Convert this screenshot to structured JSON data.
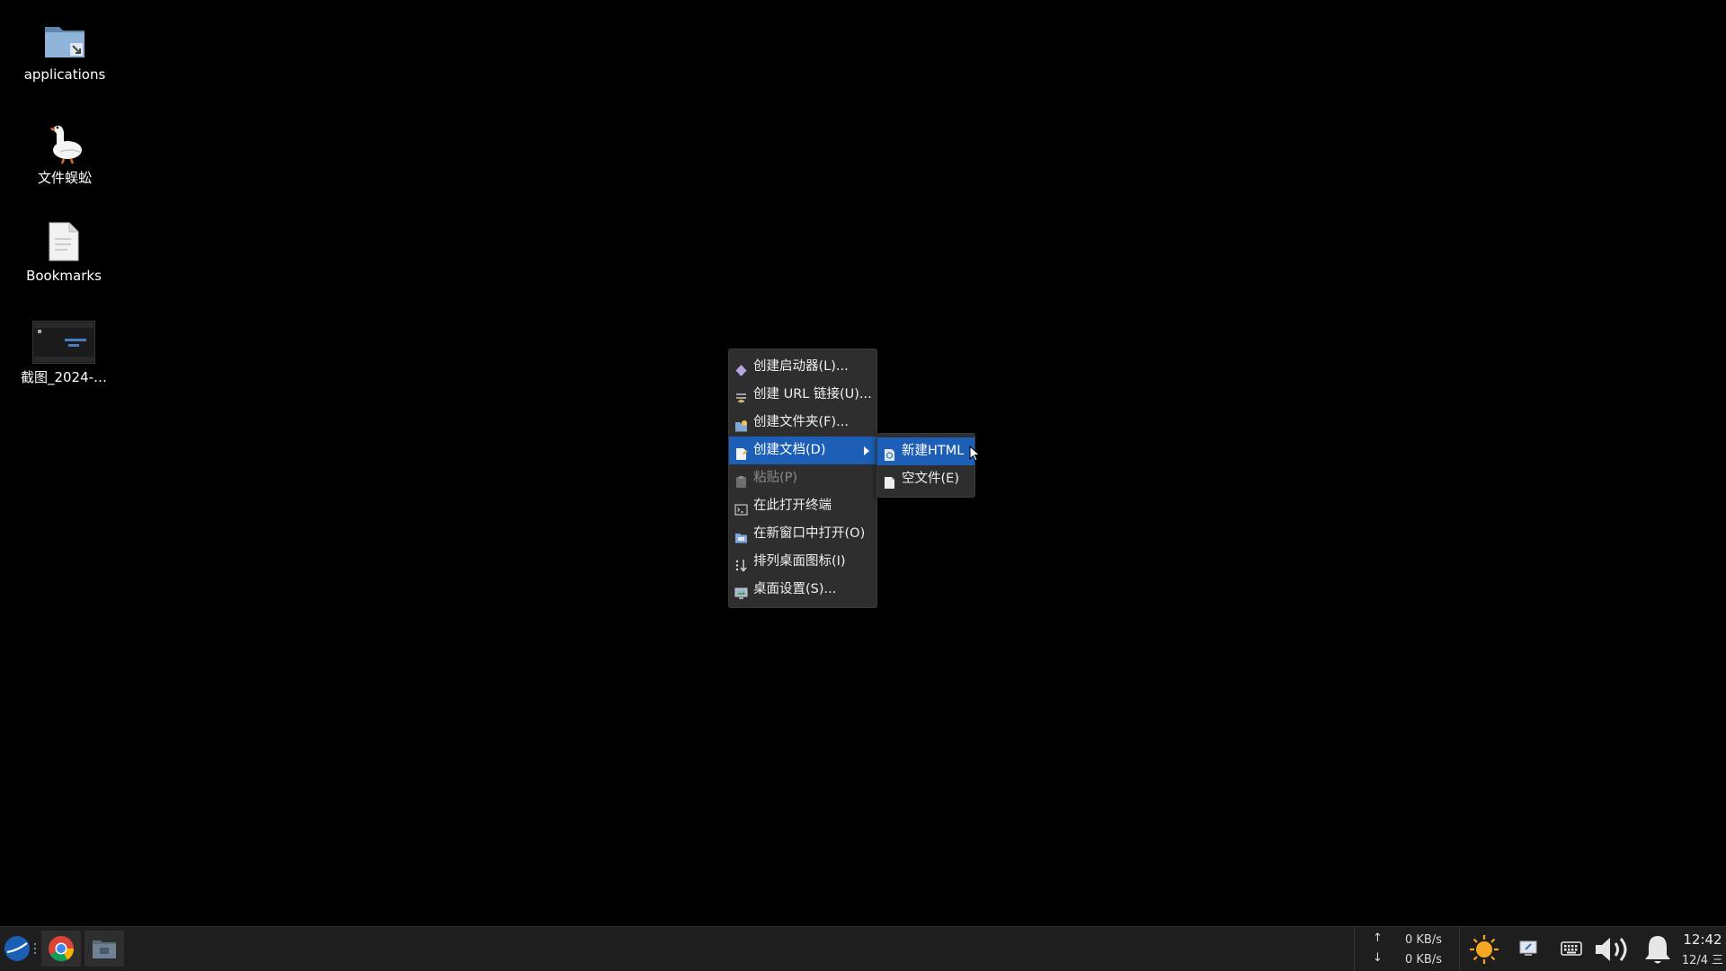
{
  "desktop": {
    "icons": [
      {
        "label": "applications",
        "icon": "folder-link-icon"
      },
      {
        "label": "文件蜈蚣",
        "icon": "goose-icon"
      },
      {
        "label": "Bookmarks",
        "icon": "document-icon"
      },
      {
        "label": "截图_2024-…",
        "icon": "screenshot-thumbnail-icon"
      }
    ]
  },
  "context_menu": {
    "items": [
      {
        "label": "创建启动器(L)...",
        "icon": "launcher-icon"
      },
      {
        "label": "创建 URL 链接(U)...",
        "icon": "url-link-icon"
      },
      {
        "label": "创建文件夹(F)...",
        "icon": "new-folder-icon"
      },
      {
        "label": "创建文档(D)",
        "icon": "document-icon"
      },
      {
        "label": "粘贴(P)",
        "icon": "paste-icon"
      },
      {
        "label": "在此打开终端",
        "icon": "terminal-icon"
      },
      {
        "label": "在新窗口中打开(O)",
        "icon": "open-window-icon"
      },
      {
        "label": "排列桌面图标(I)",
        "icon": "sort-icon"
      },
      {
        "label": "桌面设置(S)...",
        "icon": "desktop-settings-icon"
      }
    ],
    "submenu": {
      "items": [
        {
          "label": "新建HTML",
          "icon": "html-file-icon"
        },
        {
          "label": "空文件(E)",
          "icon": "blank-file-icon"
        }
      ]
    }
  },
  "taskbar": {
    "apps": [
      {
        "name": "start-menu",
        "icon": "deepin-logo-icon"
      },
      {
        "name": "chrome",
        "icon": "chrome-icon"
      },
      {
        "name": "file-manager",
        "icon": "file-manager-icon"
      }
    ],
    "network": {
      "up": "0 KB/s",
      "down": "0 KB/s",
      "up_arrow": "↑",
      "down_arrow": "↓"
    },
    "clock": {
      "time": "12:42",
      "date": "12/4 三"
    }
  },
  "colors": {
    "desktop_bg": "#000000",
    "menu_bg": "#2e2e2e",
    "highlight": "#1d5fb7",
    "taskbar_bg": "#1e1e1e"
  }
}
